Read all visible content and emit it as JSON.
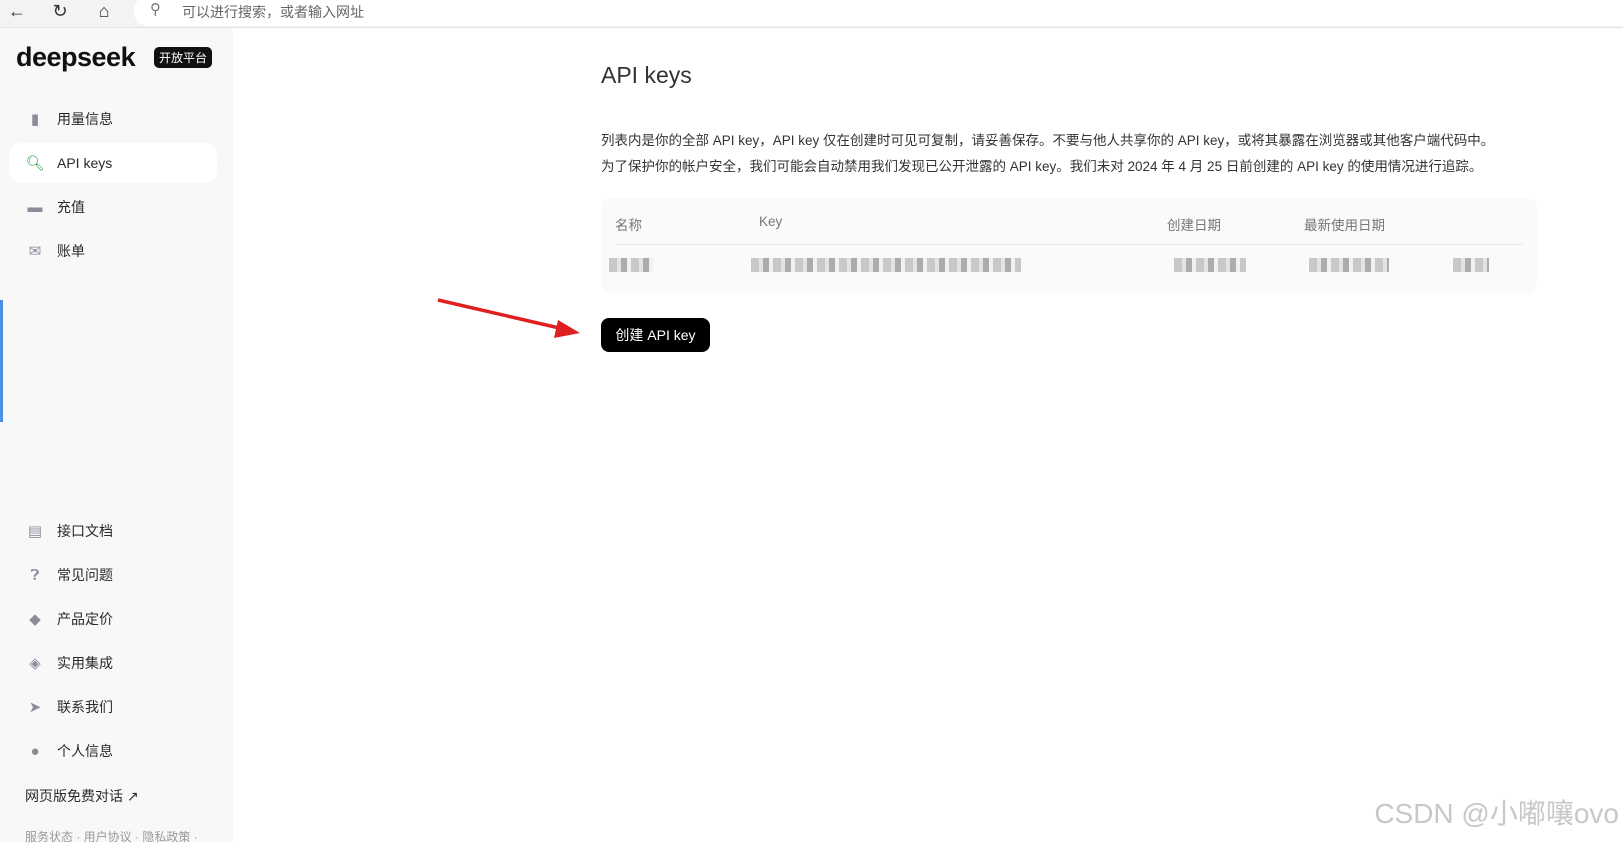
{
  "browser": {
    "address_placeholder": "可以进行搜索，或者输入网址"
  },
  "sidebar": {
    "logo": "deepseek",
    "badge": "开放平台",
    "items": [
      {
        "label": "用量信息",
        "icon": "bar-chart-icon"
      },
      {
        "label": "API keys",
        "icon": "key-icon",
        "active": true
      },
      {
        "label": "充值",
        "icon": "card-icon"
      },
      {
        "label": "账单",
        "icon": "bill-icon"
      }
    ],
    "bottom_items": [
      {
        "label": "接口文档",
        "icon": "document-icon"
      },
      {
        "label": "常见问题",
        "icon": "question-icon"
      },
      {
        "label": "产品定价",
        "icon": "tag-icon"
      },
      {
        "label": "实用集成",
        "icon": "layers-icon"
      },
      {
        "label": "联系我们",
        "icon": "send-icon"
      },
      {
        "label": "个人信息",
        "icon": "user-icon"
      }
    ],
    "web_chat_link": "网页版免费对话 ↗",
    "footer": "服务状态 · 用户协议 · 隐私政策 ·"
  },
  "main": {
    "title": "API keys",
    "desc_line1": "列表内是你的全部 API key，API key 仅在创建时可见可复制，请妥善保存。不要与他人共享你的 API key，或将其暴露在浏览器或其他客户端代码中。",
    "desc_line2": "为了保护你的帐户安全，我们可能会自动禁用我们发现已公开泄露的 API key。我们未对 2024 年 4 月 25 日前创建的 API key 的使用情况进行追踪。",
    "table": {
      "headers": [
        "名称",
        "Key",
        "创建日期",
        "最新使用日期"
      ]
    },
    "create_button": "创建 API key"
  },
  "watermark": "CSDN @小嘟嚷ovo",
  "colors": {
    "accent": "#2f9e44",
    "button": "#000000",
    "arrow": "#e02020"
  }
}
